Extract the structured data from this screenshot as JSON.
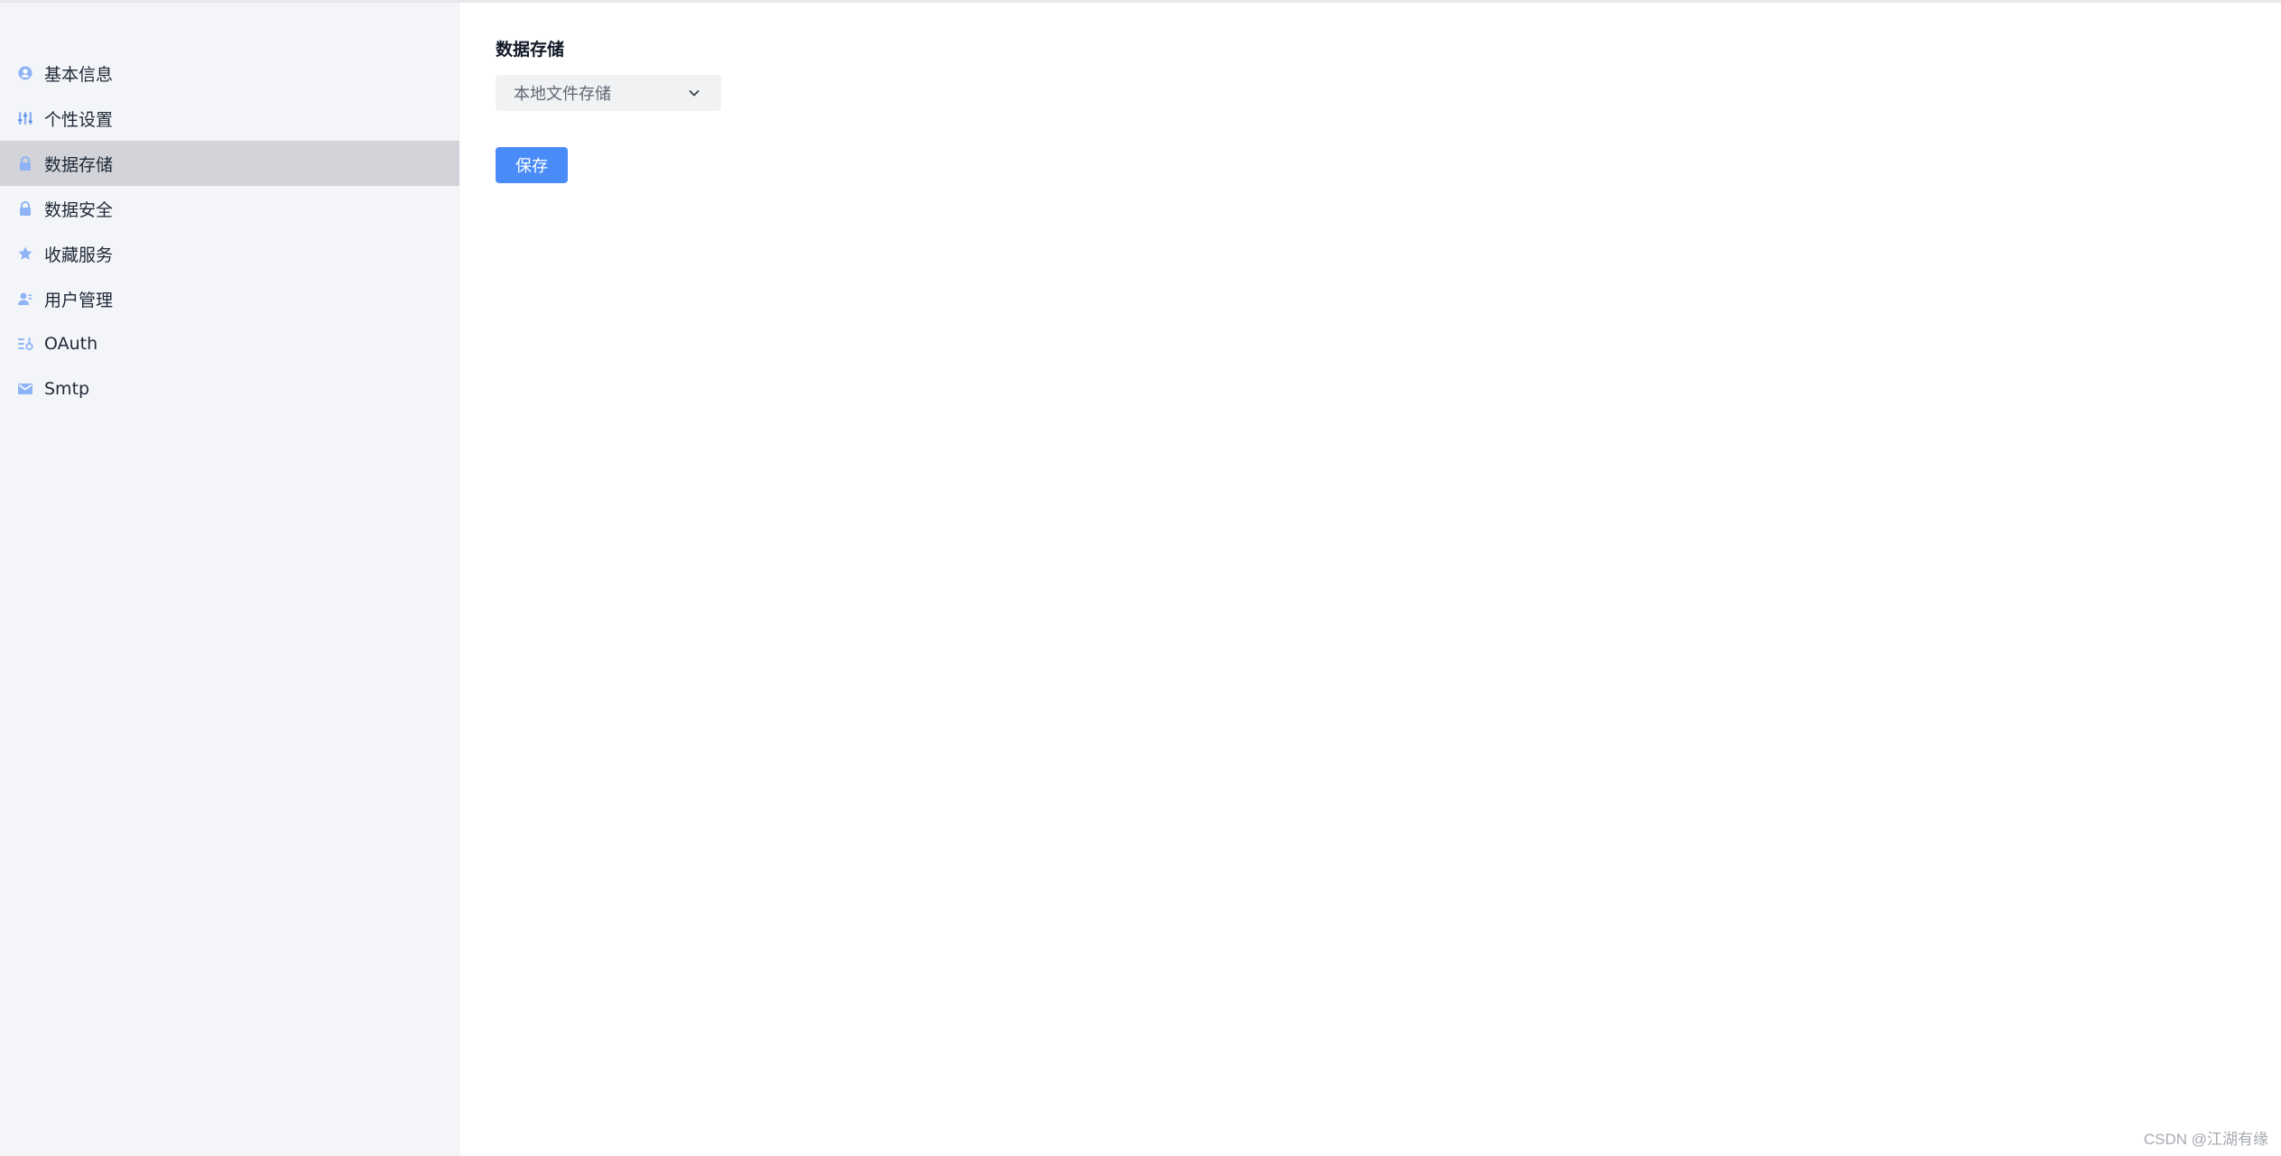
{
  "sidebar": {
    "items": [
      {
        "label": "基本信息",
        "icon": "user-circle-icon",
        "active": false
      },
      {
        "label": "个性设置",
        "icon": "sliders-icon",
        "active": false
      },
      {
        "label": "数据存储",
        "icon": "lock-icon",
        "active": true
      },
      {
        "label": "数据安全",
        "icon": "lock-icon",
        "active": false
      },
      {
        "label": "收藏服务",
        "icon": "star-icon",
        "active": false
      },
      {
        "label": "用户管理",
        "icon": "user-manage-icon",
        "active": false
      },
      {
        "label": "OAuth",
        "icon": "oauth-icon",
        "active": false
      },
      {
        "label": "Smtp",
        "icon": "mail-icon",
        "active": false
      }
    ]
  },
  "main": {
    "section_title": "数据存储",
    "storage_select": {
      "value": "本地文件存储"
    },
    "save_label": "保存"
  },
  "watermark": "CSDN @江湖有缘",
  "colors": {
    "sidebar_bg": "#f3f5f9",
    "active_bg": "#d2d4d9",
    "icon_blue": "#8fb4f5",
    "primary": "#4a8cf7"
  }
}
